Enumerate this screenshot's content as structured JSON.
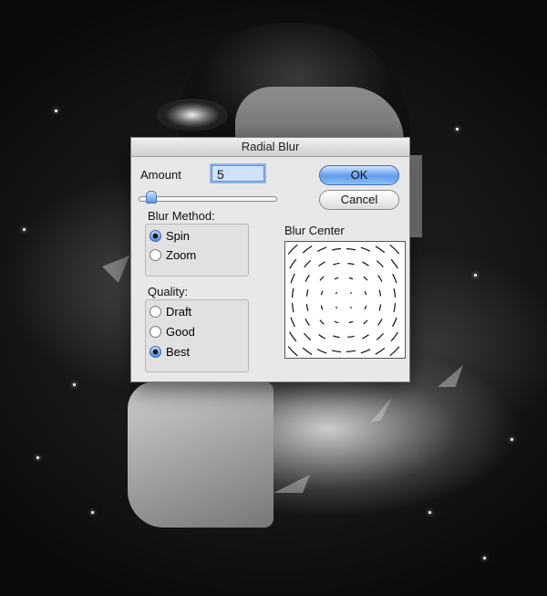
{
  "dialog": {
    "title": "Radial Blur",
    "amount_label": "Amount",
    "amount_value": "5",
    "amount_slider_fraction": 0.05,
    "ok_label": "OK",
    "cancel_label": "Cancel",
    "blur_method": {
      "heading": "Blur Method:",
      "options": [
        {
          "label": "Spin",
          "selected": true
        },
        {
          "label": "Zoom",
          "selected": false
        }
      ]
    },
    "quality": {
      "heading": "Quality:",
      "options": [
        {
          "label": "Draft",
          "selected": false
        },
        {
          "label": "Good",
          "selected": false
        },
        {
          "label": "Best",
          "selected": true
        }
      ]
    },
    "blur_center_label": "Blur Center"
  },
  "colors": {
    "accent": "#5e9cec",
    "dialog_bg": "#e8e8e8"
  }
}
